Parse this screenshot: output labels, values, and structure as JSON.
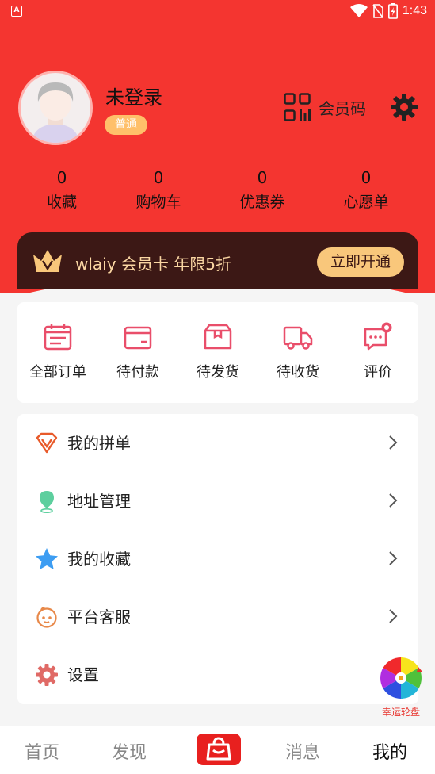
{
  "status_bar": {
    "time": "1:43"
  },
  "profile": {
    "username": "未登录",
    "level": "普通",
    "member_code_label": "会员码"
  },
  "stats": [
    {
      "value": "0",
      "label": "收藏"
    },
    {
      "value": "0",
      "label": "购物车"
    },
    {
      "value": "0",
      "label": "优惠券"
    },
    {
      "value": "0",
      "label": "心愿单"
    }
  ],
  "vip": {
    "text": "wlaiy 会员卡 年限5折",
    "button": "立即开通"
  },
  "orders": [
    {
      "label": "全部订单",
      "icon": "calendar-list-icon"
    },
    {
      "label": "待付款",
      "icon": "wallet-icon"
    },
    {
      "label": "待发货",
      "icon": "box-icon"
    },
    {
      "label": "待收货",
      "icon": "truck-icon"
    },
    {
      "label": "评价",
      "icon": "chat-bubble-icon"
    }
  ],
  "menu": [
    {
      "label": "我的拼单",
      "icon": "diamond-v-icon"
    },
    {
      "label": "地址管理",
      "icon": "location-pin-icon"
    },
    {
      "label": "我的收藏",
      "icon": "star-icon"
    },
    {
      "label": "平台客服",
      "icon": "service-face-icon"
    },
    {
      "label": "设置",
      "icon": "gear-icon"
    }
  ],
  "lucky_wheel": {
    "label": "幸运轮盘"
  },
  "tabs": [
    {
      "label": "首页"
    },
    {
      "label": "发现"
    },
    {
      "label": "消息"
    },
    {
      "label": "我的"
    }
  ],
  "colors": {
    "primary": "#f43530",
    "vip_bg": "#3c1815",
    "vip_gold": "#f9c77b",
    "badge": "#ffc06a"
  }
}
